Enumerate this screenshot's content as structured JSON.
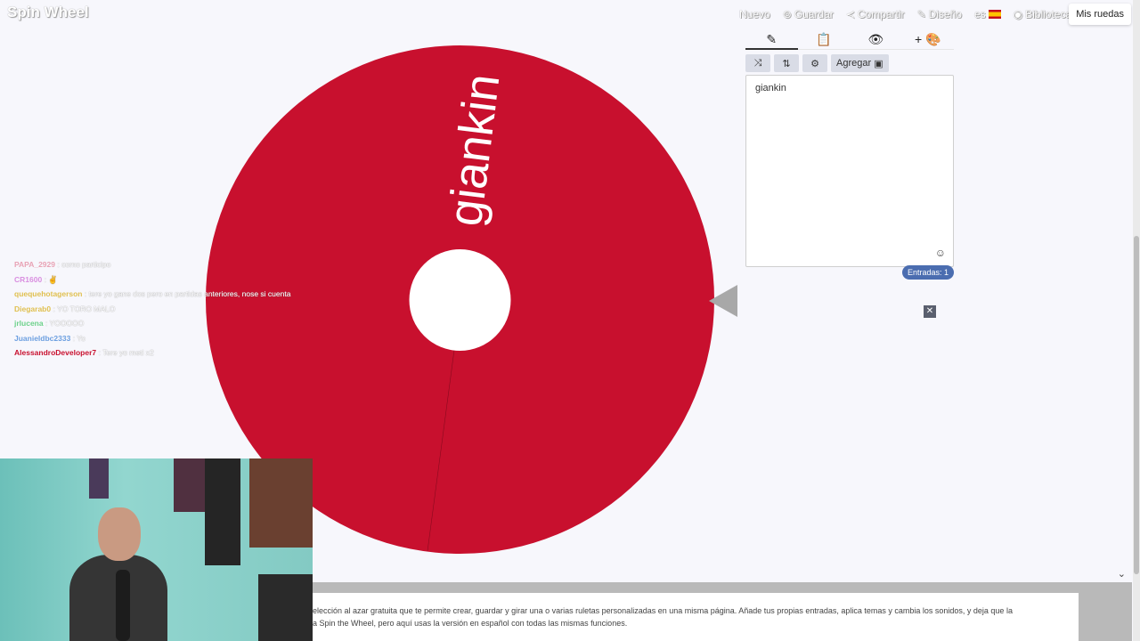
{
  "app": {
    "logo": "Spin Wheel"
  },
  "nav": {
    "items": [
      {
        "label": "Nuevo",
        "icon": "new-icon"
      },
      {
        "label": "Guardar",
        "icon": "save-icon"
      },
      {
        "label": "Compartir",
        "icon": "share-icon"
      },
      {
        "label": "Diseño",
        "icon": "brush-icon"
      },
      {
        "label": "es",
        "icon": "flag-spain"
      },
      {
        "label": "Biblioteca",
        "icon": "globe-icon"
      }
    ],
    "my_wheels": "Mis ruedas"
  },
  "wheel": {
    "entries": [
      "giankin"
    ],
    "color": "#c8102e",
    "label_color": "#ffffff"
  },
  "editor": {
    "tabs": [
      "✎",
      "📋",
      "👁",
      "+ 🎨"
    ],
    "tools": {
      "shuffle": "⤨",
      "sort": "⇅",
      "settings": "⚙",
      "add_label": "Agregar"
    },
    "entries_text": "giankin",
    "count_badge": "Entradas: 1"
  },
  "chat": [
    {
      "user": "PAPA_2929",
      "user_color": "#e8a3b5",
      "text": ": como participo"
    },
    {
      "user": "CR1600",
      "user_color": "#d98fe0",
      "text": ": ✌"
    },
    {
      "user": "quequehotagerson",
      "user_color": "#e0c050",
      "text": ": tere yo gane dos pero en partidas anteriores, nose si cuenta"
    },
    {
      "user": "Diegarab0",
      "user_color": "#e0c050",
      "text": ": YO TORO MALO"
    },
    {
      "user": "jrlucena",
      "user_color": "#6cd18a",
      "text": ": YOOOOO"
    },
    {
      "user": "Juanieldbc2333",
      "user_color": "#6c9fe0",
      "text": ": Yo"
    },
    {
      "user": "AlessandroDeveloper7",
      "user_color": "#c8102e",
      "text": ": Tere yo meti x2"
    }
  ],
  "description": {
    "line1": "elección al azar gratuita que te permite crear, guardar y girar una o varias ruletas personalizadas en una misma página. Añade tus propias entradas, aplica temas y cambia los sonidos, y deja que la",
    "line2": "a Spin the Wheel, pero aquí usas la versión en español con todas las mismas funciones."
  }
}
